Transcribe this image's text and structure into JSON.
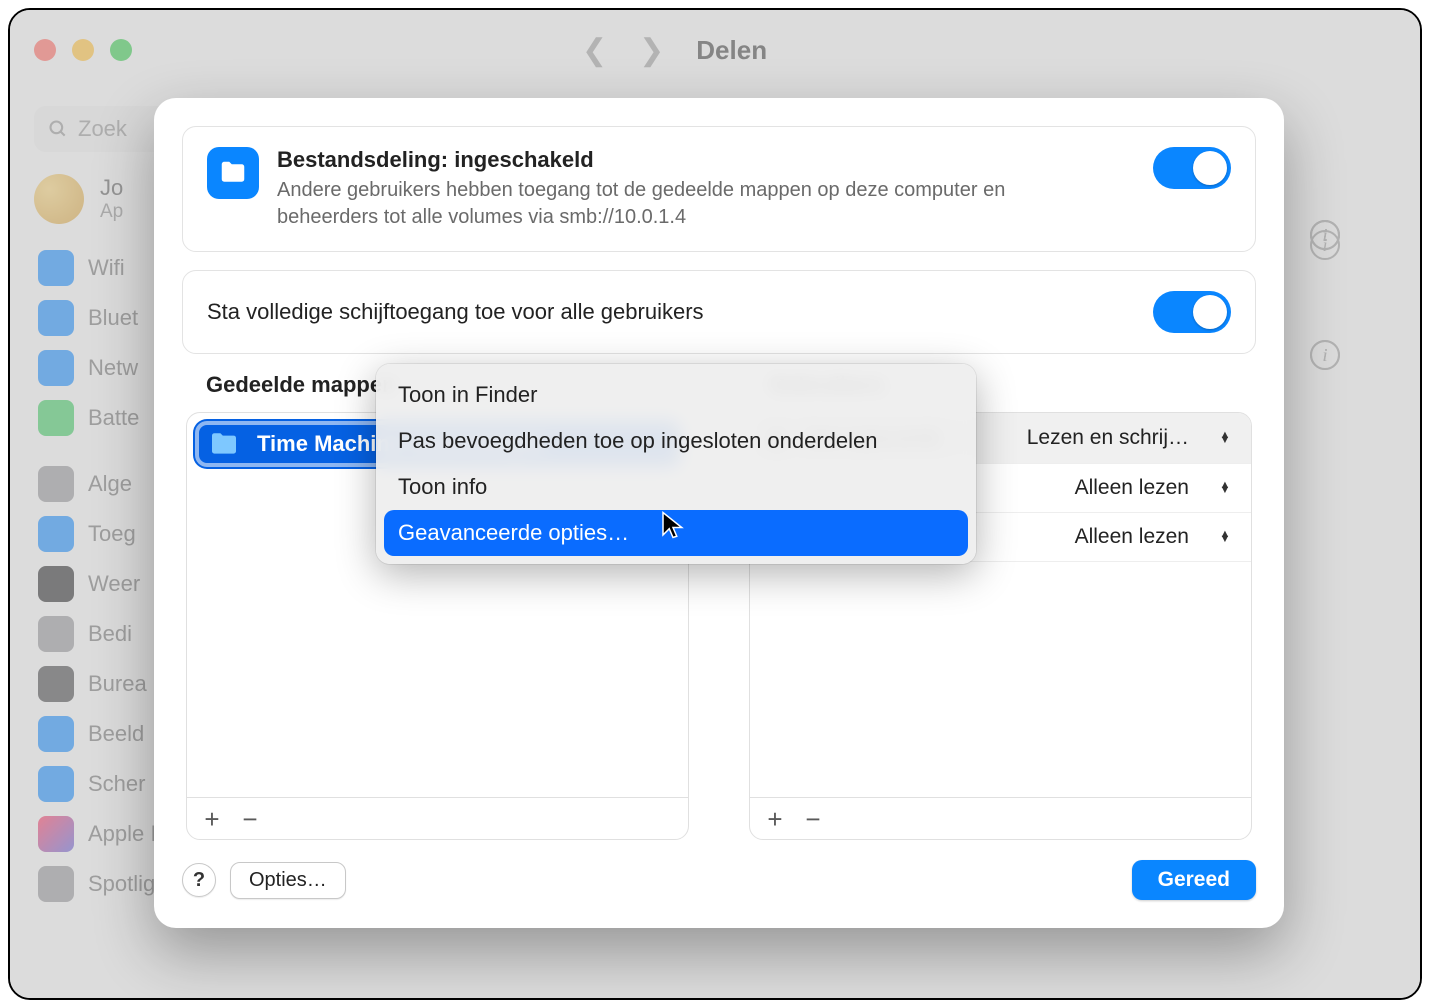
{
  "bg": {
    "title": "Delen",
    "search_placeholder": "Zoek",
    "user_name": "Jo",
    "user_sub": "Ap",
    "sidebar": [
      {
        "label": "Wifi",
        "color": "#0a86ff"
      },
      {
        "label": "Bluet",
        "color": "#0a86ff"
      },
      {
        "label": "Netw",
        "color": "#0a86ff"
      },
      {
        "label": "Batte",
        "color": "#34c759"
      },
      {
        "label": "Alge",
        "color": "#8e8e93"
      },
      {
        "label": "Toeg",
        "color": "#0a86ff"
      },
      {
        "label": "Weer",
        "color": "#1c1c1e"
      },
      {
        "label": "Bedi",
        "color": "#8e8e93"
      },
      {
        "label": "Burea",
        "color": "#3a3a3c"
      },
      {
        "label": "Beeld",
        "color": "#0a86ff"
      },
      {
        "label": "Scher",
        "color": "#0a86ff"
      },
      {
        "label": "Apple Intelligence en Siri",
        "color": "#ff2d55"
      },
      {
        "label": "Spotlight",
        "color": "#8e8e93"
      }
    ]
  },
  "sheet": {
    "file_sharing_title": "Bestandsdeling: ingeschakeld",
    "file_sharing_desc": "Andere gebruikers hebben toegang tot de gedeelde mappen op deze computer en beheerders tot alle volumes via smb://10.0.1.4",
    "full_disk_label": "Sta volledige schijftoegang toe voor alle gebruikers",
    "folders_title": "Gedeelde mappen",
    "users_title": "Gebruikers",
    "selected_folder": "Time Machine-reservekopie",
    "users": [
      {
        "name": "Joe Lipscomb",
        "perm": "Lezen en schrij…"
      },
      {
        "name": "",
        "perm": "Alleen lezen"
      },
      {
        "name": "",
        "perm": "Alleen lezen"
      }
    ],
    "context_menu": {
      "items": [
        "Toon in Finder",
        "Pas bevoegdheden toe op ingesloten onderdelen",
        "Toon info",
        "Geavanceerde opties…"
      ],
      "highlighted": 3
    },
    "help": "?",
    "options_btn": "Opties…",
    "done_btn": "Gereed",
    "plus": "+",
    "minus": "−"
  }
}
